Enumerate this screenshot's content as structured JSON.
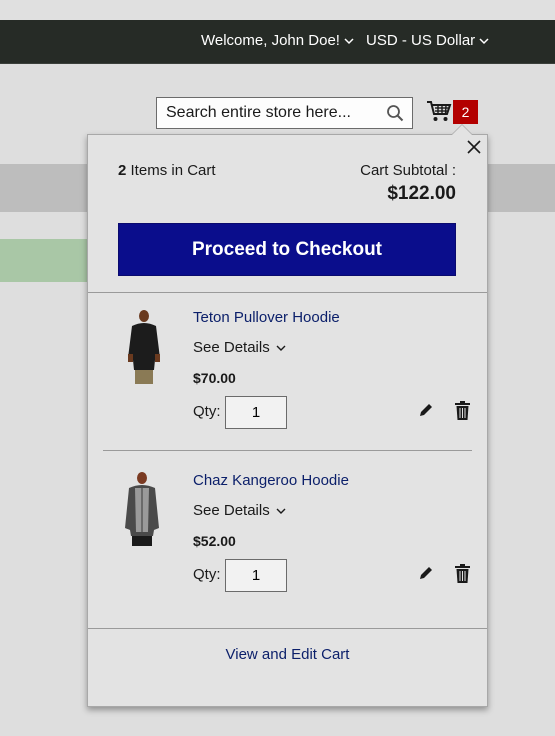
{
  "header": {
    "welcome": "Welcome, John Doe!",
    "currency": "USD - US Dollar"
  },
  "search": {
    "placeholder": "Search entire store here..."
  },
  "cart": {
    "badge_count": "2",
    "summary_count": "2",
    "summary_label": "Items in Cart",
    "subtotal_label": "Cart Subtotal :",
    "subtotal_value": "$122.00",
    "checkout_label": "Proceed to Checkout",
    "view_edit_label": "View and Edit Cart",
    "items": [
      {
        "name": "Teton Pullover Hoodie",
        "details_label": "See Details",
        "price": "$70.00",
        "qty_label": "Qty:",
        "qty": "1"
      },
      {
        "name": "Chaz Kangeroo Hoodie",
        "details_label": "See Details",
        "price": "$52.00",
        "qty_label": "Qty:",
        "qty": "1"
      }
    ]
  },
  "colors": {
    "header_bg": "#262b26",
    "checkout_bg": "#0a0d8c",
    "badge_bg": "#b30000",
    "link": "#0b1f6a"
  }
}
